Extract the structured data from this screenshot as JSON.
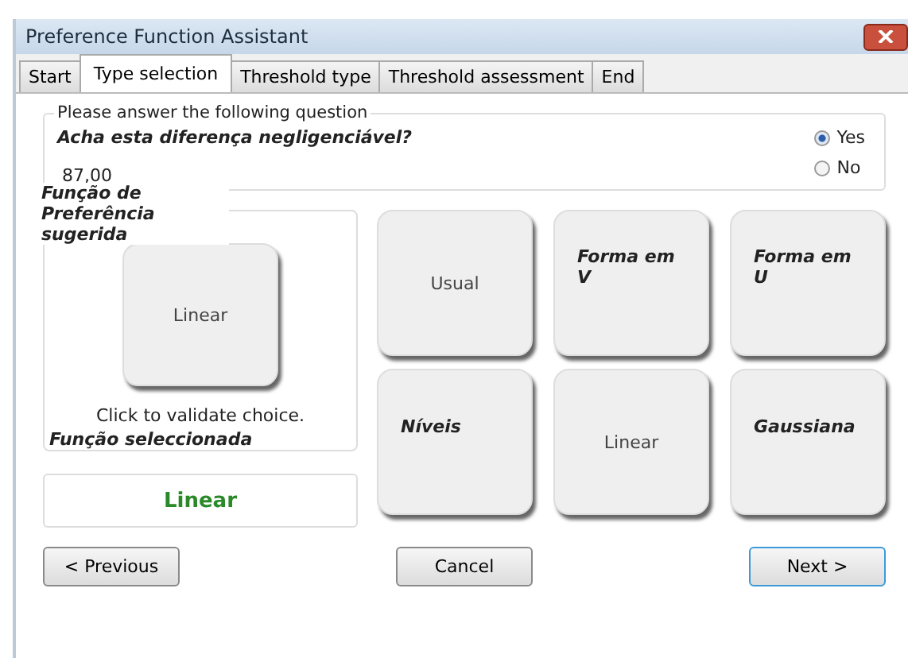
{
  "window": {
    "title": "Preference Function Assistant"
  },
  "tabs": [
    {
      "label": "Start",
      "selected": false
    },
    {
      "label": "Type selection",
      "selected": true
    },
    {
      "label": "Threshold type",
      "selected": false
    },
    {
      "label": "Threshold assessment",
      "selected": false
    },
    {
      "label": "End",
      "selected": false
    }
  ],
  "question": {
    "legend": "Please answer the following question",
    "text": "Acha esta diferença negligenciável?",
    "value": "87,00",
    "options": [
      {
        "label": "Yes",
        "selected": true
      },
      {
        "label": "No",
        "selected": false
      }
    ]
  },
  "suggested": {
    "label": "Função de Preferência sugerida",
    "function": "Linear",
    "hint": "Click to validate choice.",
    "selected_label": "Função seleccionada",
    "selected_value": "Linear"
  },
  "functions": [
    {
      "label": "Usual",
      "kind": "plain"
    },
    {
      "label": "Forma em V",
      "kind": "note"
    },
    {
      "label": "Forma em U",
      "kind": "note"
    },
    {
      "label": "Níveis",
      "kind": "note"
    },
    {
      "label": "Linear",
      "kind": "plain"
    },
    {
      "label": "Gaussiana",
      "kind": "note"
    }
  ],
  "buttons": {
    "previous": "< Previous",
    "cancel": "Cancel",
    "next": "Next >"
  }
}
